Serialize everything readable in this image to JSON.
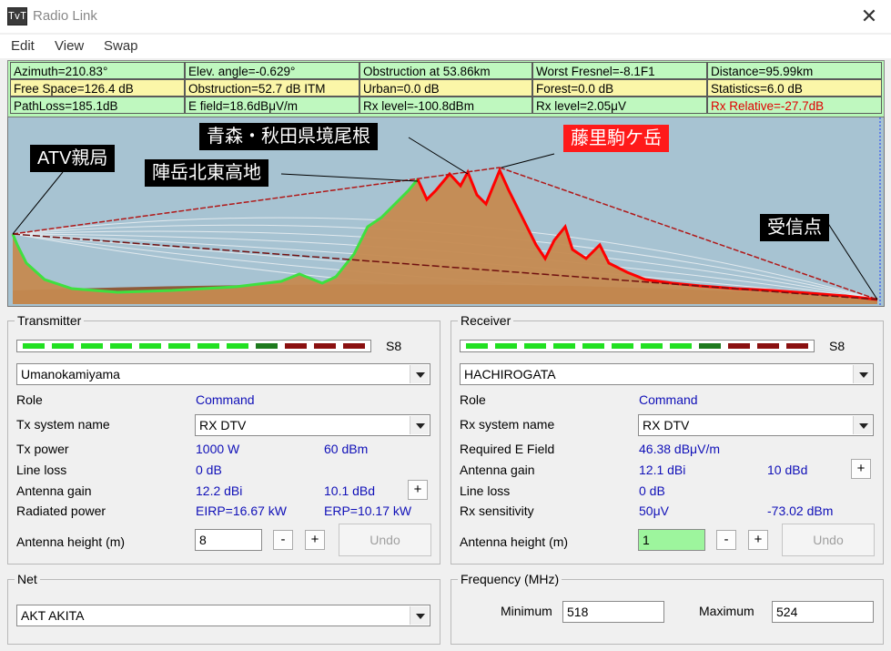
{
  "window": {
    "title": "Radio Link",
    "app_icon": "TvT",
    "close": "✕"
  },
  "menu": [
    "Edit",
    "View",
    "Swap"
  ],
  "info": {
    "row1": [
      "Azimuth=210.83°",
      "Elev. angle=-0.629°",
      "Obstruction at 53.86km",
      "Worst Fresnel=-8.1F1",
      "Distance=95.99km"
    ],
    "row2": [
      "Free Space=126.4 dB",
      "Obstruction=52.7 dB ITM",
      "Urban=0.0 dB",
      "Forest=0.0 dB",
      "Statistics=6.0 dB"
    ],
    "row3": [
      "PathLoss=185.1dB",
      "E field=18.6dBμV/m",
      "Rx level=-100.8dBm",
      "Rx level=2.05μV",
      "Rx Relative=-27.7dB"
    ]
  },
  "profile": {
    "callouts": {
      "tx": "ATV親局",
      "aomori": "青森・秋田県境尾根",
      "jingatake": "陣岳北東高地",
      "fujisato": "藤里駒ケ岳",
      "rx": "受信点"
    }
  },
  "transmitter": {
    "title": "Transmitter",
    "meter_label": "S8",
    "station": "Umanokamiyama",
    "role_label": "Role",
    "role_value": "Command",
    "system_label": "Tx system name",
    "system_value": "RX DTV",
    "power_label": "Tx power",
    "power_w": "1000 W",
    "power_dbm": "60 dBm",
    "lineloss_label": "Line loss",
    "lineloss_value": "0 dB",
    "gain_label": "Antenna gain",
    "gain_dbi": "12.2 dBi",
    "gain_dbd": "10.1 dBd",
    "radiated_label": "Radiated power",
    "eirp": "EIRP=16.67 kW",
    "erp": "ERP=10.17 kW",
    "height_label": "Antenna height (m)",
    "height_value": "8",
    "minus": "-",
    "plus": "+",
    "undo": "Undo"
  },
  "receiver": {
    "title": "Receiver",
    "meter_label": "S8",
    "station": "HACHIROGATA",
    "role_label": "Role",
    "role_value": "Command",
    "system_label": "Rx system name",
    "system_value": "RX DTV",
    "efield_label": "Required E Field",
    "efield_value": "46.38 dBμV/m",
    "gain_label": "Antenna gain",
    "gain_dbi": "12.1 dBi",
    "gain_dbd": "10 dBd",
    "lineloss_label": "Line loss",
    "lineloss_value": "0 dB",
    "sens_label": "Rx sensitivity",
    "sens_uv": "50μV",
    "sens_dbm": "-73.02 dBm",
    "height_label": "Antenna height (m)",
    "height_value": "1",
    "minus": "-",
    "plus": "+",
    "undo": "Undo"
  },
  "net": {
    "title": "Net",
    "value": "AKT AKITA"
  },
  "frequency": {
    "title": "Frequency (MHz)",
    "min_label": "Minimum",
    "min_value": "518",
    "max_label": "Maximum",
    "max_value": "524"
  },
  "colors": {
    "info_bg": "#bff8bf",
    "yellow": "#fbf6a8",
    "terrain": "#c58a50",
    "terrain_line_green": "#3fe03f",
    "terrain_line_red": "#ff0000",
    "sky": "#a7c3d2",
    "meter_green": "#22e022",
    "meter_dark_green": "#1e7a1e",
    "meter_red": "#8a1010"
  }
}
